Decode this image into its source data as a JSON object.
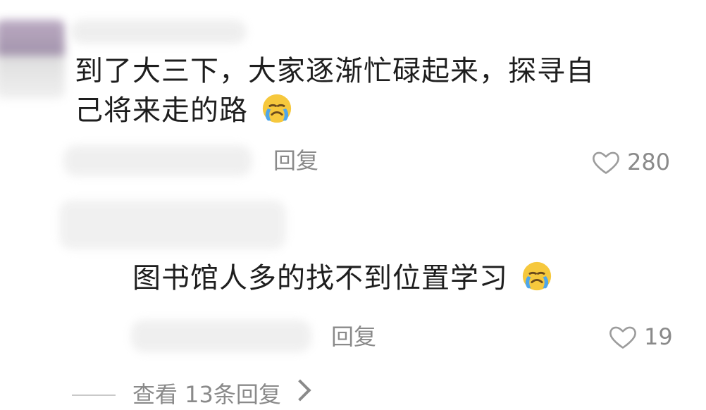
{
  "comment": {
    "text_line1": "到了大三下，大家逐渐忙碌起来，探寻自",
    "text_line2": "己将来走的路",
    "emoji": "crying-face",
    "reply_label": "回复",
    "like_count": "280"
  },
  "reply": {
    "text": "图书馆人多的找不到位置学习",
    "emoji": "crying-face",
    "reply_label": "回复",
    "like_count": "19"
  },
  "more_replies": {
    "label": "查看 13条回复"
  },
  "colors": {
    "text_primary": "#1e1e1e",
    "text_secondary": "#8a8a8a",
    "emoji_yellow": "#f6c83d",
    "emoji_blue": "#4ea6ea",
    "blur_purple": "#b9a9bf",
    "blur_gray": "#ececec"
  }
}
